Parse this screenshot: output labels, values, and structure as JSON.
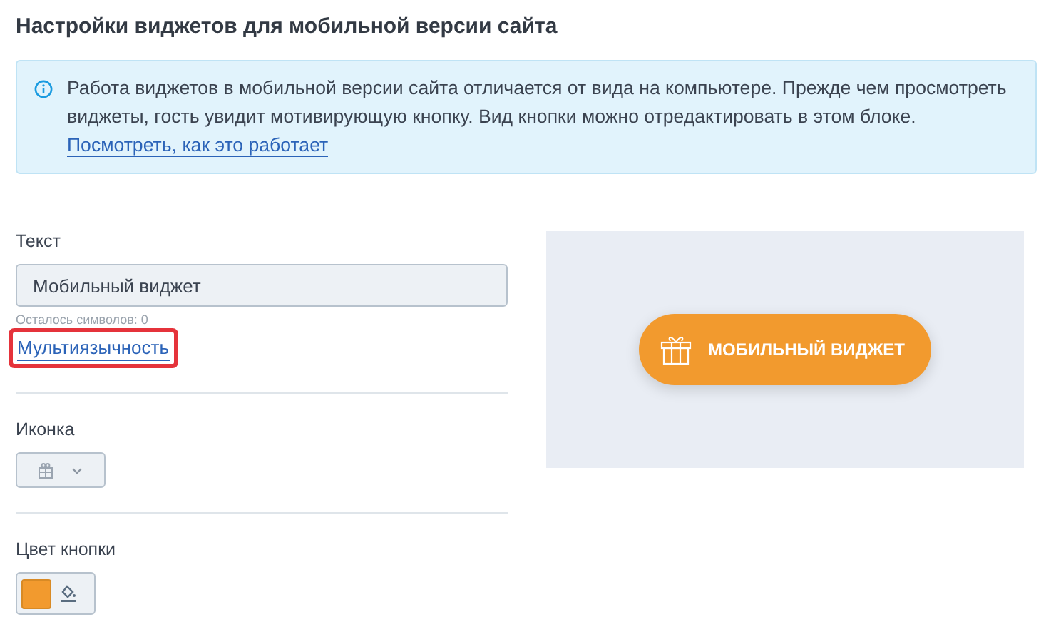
{
  "title": "Настройки виджетов для мобильной версии сайта",
  "info": {
    "text": "Работа виджетов в мобильной версии сайта отличается от вида на компьютере. Прежде чем просмотреть виджеты, гость увидит мотивирующую кнопку. Вид кнопки можно отредактировать в этом блоке.",
    "link": "Посмотреть, как это работает"
  },
  "text_field": {
    "label": "Текст",
    "value": "Мобильный виджет",
    "hint": "Осталось символов: 0",
    "link": "Мультиязычность",
    "highlighted": true
  },
  "icon_field": {
    "label": "Иконка"
  },
  "color_field": {
    "label": "Цвет кнопки",
    "color": "#f29a2e"
  },
  "preview": {
    "button_label": "МОБИЛЬНЫЙ ВИДЖЕТ"
  }
}
